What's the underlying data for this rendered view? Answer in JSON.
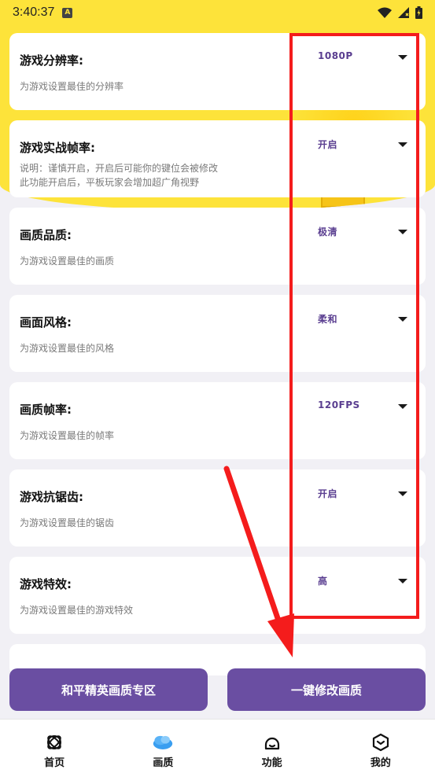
{
  "status_bar": {
    "time": "3:40:37",
    "notification_badge": "A"
  },
  "settings": [
    {
      "title": "游戏分辨率:",
      "value": "1080P",
      "description": "为游戏设置最佳的分辨率"
    },
    {
      "title": "游戏实战帧率:",
      "value": "开启",
      "description": "说明：谨慎开启，开启后可能你的键位会被修改\n此功能开启后，平板玩家会增加超广角视野"
    },
    {
      "title": "画质品质:",
      "value": "极清",
      "description": "为游戏设置最佳的画质"
    },
    {
      "title": "画面风格:",
      "value": "柔和",
      "description": "为游戏设置最佳的风格"
    },
    {
      "title": "画质帧率:",
      "value": "120FPS",
      "description": "为游戏设置最佳的帧率"
    },
    {
      "title": "游戏抗锯齿:",
      "value": "开启",
      "description": "为游戏设置最佳的锯齿"
    },
    {
      "title": "游戏特效:",
      "value": "高",
      "description": "为游戏设置最佳的游戏特效"
    }
  ],
  "actions": {
    "left_label": "和平精英画质专区",
    "right_label": "一键修改画质"
  },
  "bottom_nav": [
    {
      "label": "首页",
      "icon": "home-orbit-icon"
    },
    {
      "label": "画质",
      "icon": "cloud-icon",
      "active": true
    },
    {
      "label": "功能",
      "icon": "function-icon"
    },
    {
      "label": "我的",
      "icon": "profile-box-icon"
    }
  ],
  "colors": {
    "banner": "#fde33a",
    "accent": "#6a4ea2",
    "value_text": "#5a3e90",
    "annotation": "#f41c1c",
    "active_nav": "#3a9ef0"
  }
}
